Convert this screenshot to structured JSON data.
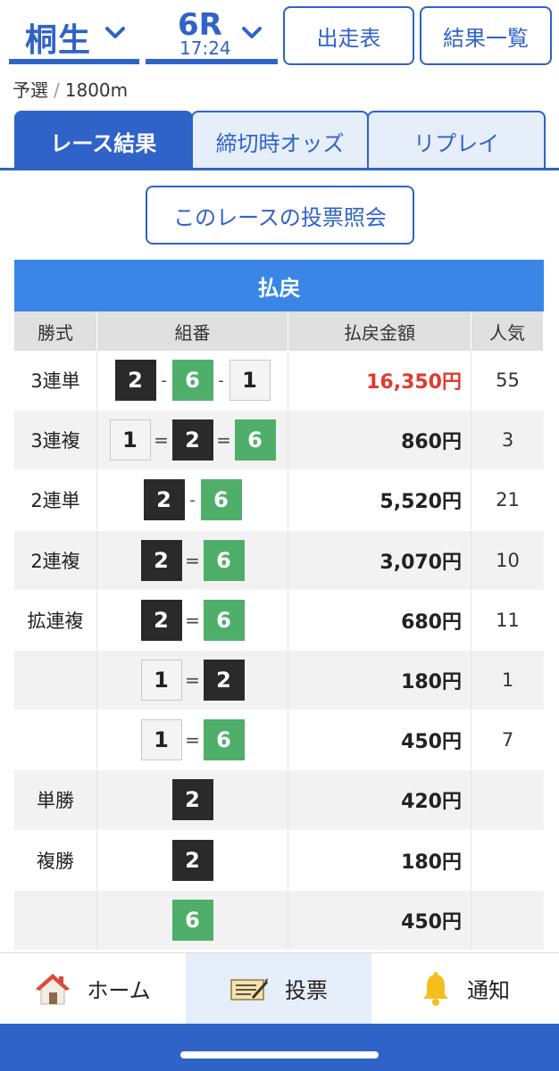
{
  "header": {
    "venue": "桐生",
    "race_number": "6R",
    "race_time": "17:24",
    "racecard_button": "出走表",
    "results_list_button": "結果一覧"
  },
  "race_info": {
    "category": "予選",
    "separator": "/",
    "distance": "1800m"
  },
  "tabs": [
    {
      "label": "レース結果",
      "active": true
    },
    {
      "label": "締切時オッズ",
      "active": false
    },
    {
      "label": "リプレイ",
      "active": false
    }
  ],
  "vote_inquiry_button": "このレースの投票照会",
  "payout": {
    "title": "払戻",
    "headers": [
      "勝式",
      "組番",
      "払戻金額",
      "人気"
    ],
    "rows": [
      {
        "type": "3連単",
        "combo": [
          "2",
          "6",
          "1"
        ],
        "connector": "-",
        "amount": "16,350円",
        "popularity": "55",
        "highlight": true
      },
      {
        "type": "3連複",
        "combo": [
          "1",
          "2",
          "6"
        ],
        "connector": "=",
        "amount": "860円",
        "popularity": "3"
      },
      {
        "type": "2連単",
        "combo": [
          "2",
          "6"
        ],
        "connector": "-",
        "amount": "5,520円",
        "popularity": "21"
      },
      {
        "type": "2連複",
        "combo": [
          "2",
          "6"
        ],
        "connector": "=",
        "amount": "3,070円",
        "popularity": "10"
      },
      {
        "type": "拡連複",
        "combo": [
          "2",
          "6"
        ],
        "connector": "=",
        "amount": "680円",
        "popularity": "11"
      },
      {
        "type": "",
        "combo": [
          "1",
          "2"
        ],
        "connector": "=",
        "amount": "180円",
        "popularity": "1"
      },
      {
        "type": "",
        "combo": [
          "1",
          "6"
        ],
        "connector": "=",
        "amount": "450円",
        "popularity": "7"
      },
      {
        "type": "単勝",
        "combo": [
          "2"
        ],
        "connector": "",
        "amount": "420円",
        "popularity": ""
      },
      {
        "type": "複勝",
        "combo": [
          "2"
        ],
        "connector": "",
        "amount": "180円",
        "popularity": ""
      },
      {
        "type": "",
        "combo": [
          "6"
        ],
        "connector": "",
        "amount": "450円",
        "popularity": ""
      }
    ]
  },
  "bottom_nav": {
    "home": "ホーム",
    "vote": "投票",
    "notify": "通知"
  },
  "colors": {
    "accent": "#2f63c8",
    "table_header": "#3a86e6",
    "highlight_amount": "#e03a2e",
    "boat_1": "#f4f4f4",
    "boat_2": "#2a2a2a",
    "boat_6": "#4fae69"
  }
}
